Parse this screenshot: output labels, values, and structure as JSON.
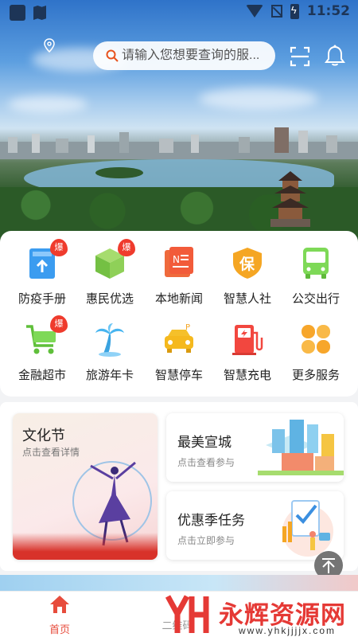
{
  "status_bar": {
    "time": "11:52"
  },
  "search": {
    "placeholder": "请输入您想要查询的服..."
  },
  "services": [
    {
      "label": "防疫手册",
      "icon": "manual-icon",
      "badge": "爆"
    },
    {
      "label": "惠民优选",
      "icon": "box-icon",
      "badge": "爆"
    },
    {
      "label": "本地新闻",
      "icon": "news-icon",
      "badge": ""
    },
    {
      "label": "智慧人社",
      "icon": "shield-icon",
      "badge": ""
    },
    {
      "label": "公交出行",
      "icon": "bus-icon",
      "badge": ""
    },
    {
      "label": "金融超市",
      "icon": "cart-icon",
      "badge": "爆"
    },
    {
      "label": "旅游年卡",
      "icon": "palm-tree-icon",
      "badge": ""
    },
    {
      "label": "智慧停车",
      "icon": "car-icon",
      "badge": ""
    },
    {
      "label": "智慧充电",
      "icon": "charger-icon",
      "badge": ""
    },
    {
      "label": "更多服务",
      "icon": "more-services-icon",
      "badge": ""
    }
  ],
  "shield_char": "保",
  "features": {
    "culture": {
      "title": "文化节",
      "subtitle": "点击查看详情"
    },
    "city": {
      "title": "最美宣城",
      "subtitle": "点击查看参与"
    },
    "task": {
      "title": "优惠季任务",
      "subtitle": "点击立即参与"
    }
  },
  "bottom_nav": {
    "home_label": "首页",
    "second_label": "二维码"
  },
  "watermark": {
    "text": "永辉资源网",
    "url": "www.yhkjjjjx.com"
  },
  "colors": {
    "accent": "#e74c3c",
    "badge": "#ef3b2d"
  }
}
